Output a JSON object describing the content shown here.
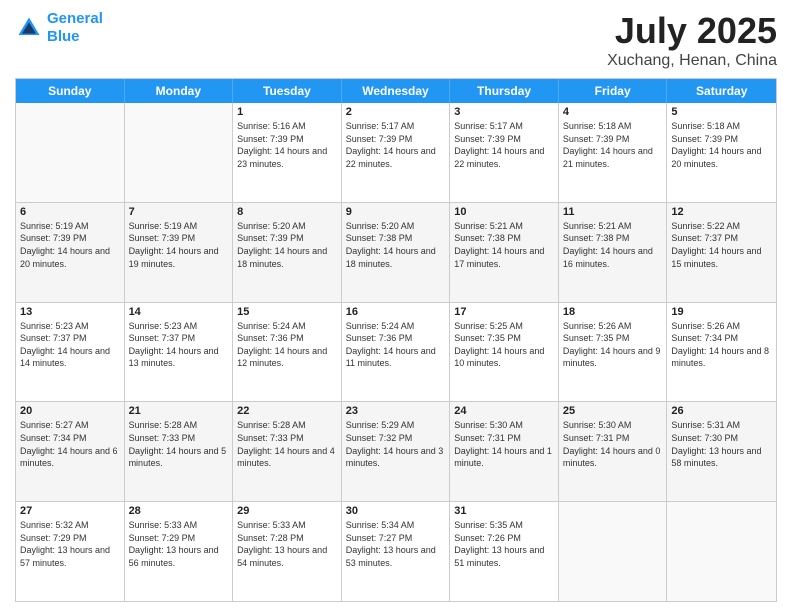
{
  "header": {
    "logo_line1": "General",
    "logo_line2": "Blue",
    "main_title": "July 2025",
    "subtitle": "Xuchang, Henan, China"
  },
  "days_of_week": [
    "Sunday",
    "Monday",
    "Tuesday",
    "Wednesday",
    "Thursday",
    "Friday",
    "Saturday"
  ],
  "weeks": [
    [
      {
        "day": "",
        "info": "",
        "empty": true
      },
      {
        "day": "",
        "info": "",
        "empty": true
      },
      {
        "day": "1",
        "info": "Sunrise: 5:16 AM\nSunset: 7:39 PM\nDaylight: 14 hours and 23 minutes."
      },
      {
        "day": "2",
        "info": "Sunrise: 5:17 AM\nSunset: 7:39 PM\nDaylight: 14 hours and 22 minutes."
      },
      {
        "day": "3",
        "info": "Sunrise: 5:17 AM\nSunset: 7:39 PM\nDaylight: 14 hours and 22 minutes."
      },
      {
        "day": "4",
        "info": "Sunrise: 5:18 AM\nSunset: 7:39 PM\nDaylight: 14 hours and 21 minutes."
      },
      {
        "day": "5",
        "info": "Sunrise: 5:18 AM\nSunset: 7:39 PM\nDaylight: 14 hours and 20 minutes."
      }
    ],
    [
      {
        "day": "6",
        "info": "Sunrise: 5:19 AM\nSunset: 7:39 PM\nDaylight: 14 hours and 20 minutes.",
        "shaded": true
      },
      {
        "day": "7",
        "info": "Sunrise: 5:19 AM\nSunset: 7:39 PM\nDaylight: 14 hours and 19 minutes.",
        "shaded": true
      },
      {
        "day": "8",
        "info": "Sunrise: 5:20 AM\nSunset: 7:39 PM\nDaylight: 14 hours and 18 minutes.",
        "shaded": true
      },
      {
        "day": "9",
        "info": "Sunrise: 5:20 AM\nSunset: 7:38 PM\nDaylight: 14 hours and 18 minutes.",
        "shaded": true
      },
      {
        "day": "10",
        "info": "Sunrise: 5:21 AM\nSunset: 7:38 PM\nDaylight: 14 hours and 17 minutes.",
        "shaded": true
      },
      {
        "day": "11",
        "info": "Sunrise: 5:21 AM\nSunset: 7:38 PM\nDaylight: 14 hours and 16 minutes.",
        "shaded": true
      },
      {
        "day": "12",
        "info": "Sunrise: 5:22 AM\nSunset: 7:37 PM\nDaylight: 14 hours and 15 minutes.",
        "shaded": true
      }
    ],
    [
      {
        "day": "13",
        "info": "Sunrise: 5:23 AM\nSunset: 7:37 PM\nDaylight: 14 hours and 14 minutes."
      },
      {
        "day": "14",
        "info": "Sunrise: 5:23 AM\nSunset: 7:37 PM\nDaylight: 14 hours and 13 minutes."
      },
      {
        "day": "15",
        "info": "Sunrise: 5:24 AM\nSunset: 7:36 PM\nDaylight: 14 hours and 12 minutes."
      },
      {
        "day": "16",
        "info": "Sunrise: 5:24 AM\nSunset: 7:36 PM\nDaylight: 14 hours and 11 minutes."
      },
      {
        "day": "17",
        "info": "Sunrise: 5:25 AM\nSunset: 7:35 PM\nDaylight: 14 hours and 10 minutes."
      },
      {
        "day": "18",
        "info": "Sunrise: 5:26 AM\nSunset: 7:35 PM\nDaylight: 14 hours and 9 minutes."
      },
      {
        "day": "19",
        "info": "Sunrise: 5:26 AM\nSunset: 7:34 PM\nDaylight: 14 hours and 8 minutes."
      }
    ],
    [
      {
        "day": "20",
        "info": "Sunrise: 5:27 AM\nSunset: 7:34 PM\nDaylight: 14 hours and 6 minutes.",
        "shaded": true
      },
      {
        "day": "21",
        "info": "Sunrise: 5:28 AM\nSunset: 7:33 PM\nDaylight: 14 hours and 5 minutes.",
        "shaded": true
      },
      {
        "day": "22",
        "info": "Sunrise: 5:28 AM\nSunset: 7:33 PM\nDaylight: 14 hours and 4 minutes.",
        "shaded": true
      },
      {
        "day": "23",
        "info": "Sunrise: 5:29 AM\nSunset: 7:32 PM\nDaylight: 14 hours and 3 minutes.",
        "shaded": true
      },
      {
        "day": "24",
        "info": "Sunrise: 5:30 AM\nSunset: 7:31 PM\nDaylight: 14 hours and 1 minute.",
        "shaded": true
      },
      {
        "day": "25",
        "info": "Sunrise: 5:30 AM\nSunset: 7:31 PM\nDaylight: 14 hours and 0 minutes.",
        "shaded": true
      },
      {
        "day": "26",
        "info": "Sunrise: 5:31 AM\nSunset: 7:30 PM\nDaylight: 13 hours and 58 minutes.",
        "shaded": true
      }
    ],
    [
      {
        "day": "27",
        "info": "Sunrise: 5:32 AM\nSunset: 7:29 PM\nDaylight: 13 hours and 57 minutes."
      },
      {
        "day": "28",
        "info": "Sunrise: 5:33 AM\nSunset: 7:29 PM\nDaylight: 13 hours and 56 minutes."
      },
      {
        "day": "29",
        "info": "Sunrise: 5:33 AM\nSunset: 7:28 PM\nDaylight: 13 hours and 54 minutes."
      },
      {
        "day": "30",
        "info": "Sunrise: 5:34 AM\nSunset: 7:27 PM\nDaylight: 13 hours and 53 minutes."
      },
      {
        "day": "31",
        "info": "Sunrise: 5:35 AM\nSunset: 7:26 PM\nDaylight: 13 hours and 51 minutes."
      },
      {
        "day": "",
        "info": "",
        "empty": true
      },
      {
        "day": "",
        "info": "",
        "empty": true
      }
    ]
  ]
}
